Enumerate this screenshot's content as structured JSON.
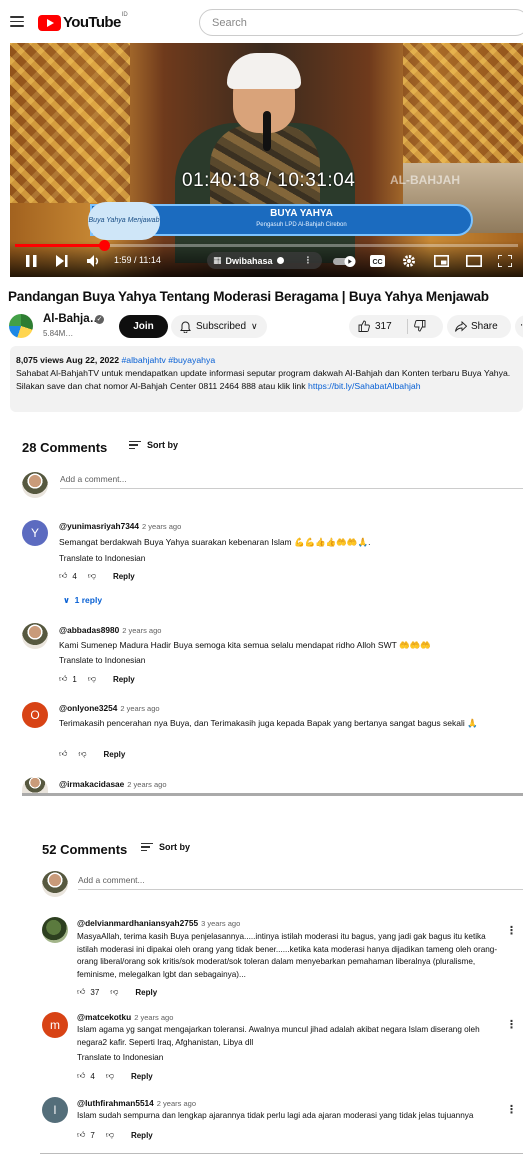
{
  "header": {
    "logo_text": "YouTube",
    "logo_country": "ID",
    "search_placeholder": "Search"
  },
  "player": {
    "overlay_timecode": "01:40:18 / 10:31:04",
    "watermark": "AL-BAHJAH",
    "banner_badge": "Buya Yahya Menjawab",
    "banner_name": "BUYA YAHYA",
    "banner_subtitle": "Pengasuh LPD Al-Bahjah Cirebon",
    "time_display": "1:59 / 11:14",
    "audio_track_label": "Dwibahasa",
    "progress_fraction": 0.177
  },
  "video": {
    "title": "Pandangan Buya Yahya Tentang Moderasi Beragama | Buya Yahya Menjawab",
    "channel_name": "Al-Bahja…",
    "subscribers": "5.84M…",
    "join_label": "Join",
    "subscribed_label": "Subscribed",
    "likes": "317",
    "share_label": "Share",
    "more_label": "⋯"
  },
  "description": {
    "meta": "8,075 views  Aug 22, 2022",
    "tags": "#albahjahtv #buyayahya",
    "text": "Sahabat Al-BahjahTV untuk mendapatkan update informasi seputar program dakwah Al-Bahjah dan Konten terbaru Buya Yahya. Silakan save dan chat nomor Al-Bahjah Center 0811 2464 888 atau klik link",
    "link": "https://bit.ly/SahabatAlbahjah"
  },
  "section1": {
    "count_label": "28 Comments",
    "sort_label": "Sort by",
    "add_placeholder": "Add a comment...",
    "comments": [
      {
        "avatar_letter": "Y",
        "avatar_color": "#5c6bc0",
        "author": "@yunimasriyah7344",
        "time": "2 years ago",
        "text": "Semangat berdakwah Buya Yahya suarakan kebenaran Islam 💪💪👍👍🤲🤲🙏.",
        "translate": "Translate to Indonesian",
        "likes": "4",
        "reply_label": "Reply",
        "replies_label": "1 reply"
      },
      {
        "avatar_letter": "",
        "avatar_color": "#e9e4dc",
        "author": "@abbadas8980",
        "time": "2 years ago",
        "text": "Kami Sumenep Madura Hadir Buya semoga kita semua selalu mendapat ridho Alloh SWT 🤲🤲🤲",
        "translate": "Translate to Indonesian",
        "likes": "1",
        "reply_label": "Reply"
      },
      {
        "avatar_letter": "O",
        "avatar_color": "#d84315",
        "author": "@onlyone3254",
        "time": "2 years ago",
        "text": "Terimakasih pencerahan nya Buya, dan Terimakasih juga kepada Bapak yang bertanya sangat bagus sekali 🙏",
        "likes": "",
        "reply_label": "Reply"
      },
      {
        "avatar_letter": "",
        "avatar_color": "#cccccc",
        "author": "@irmakacidasae",
        "time": "2 years ago"
      }
    ]
  },
  "section2": {
    "count_label": "52 Comments",
    "sort_label": "Sort by",
    "add_placeholder": "Add a comment...",
    "comments": [
      {
        "avatar_letter": "",
        "avatar_color": "#3f5a2a",
        "author": "@delvianmardhaniansyah2755",
        "time": "3 years ago",
        "text": "MasyaAllah, terima kasih Buya penjelasannya.....intinya istilah moderasi itu bagus, yang jadi gak bagus itu ketika istilah moderasi ini dipakai oleh orang yang tidak bener......ketika kata moderasi hanya dijadikan tameng oleh orang-orang liberal/orang sok kritis/sok moderat/sok toleran dalam menyebarkan pemahaman liberalnya (pluralisme, feminisme,  melegalkan lgbt dan sebagainya)...",
        "likes": "37",
        "reply_label": "Reply"
      },
      {
        "avatar_letter": "m",
        "avatar_color": "#d84315",
        "author": "@matcekotku",
        "time": "2 years ago",
        "text": "Islam agama yg sangat mengajarkan toleransi. Awalnya muncul jihad adalah akibat negara Islam diserang oleh negara2 kafir. Seperti Iraq, Afghanistan, Libya dll",
        "translate": "Translate to Indonesian",
        "likes": "4",
        "reply_label": "Reply"
      },
      {
        "avatar_letter": "l",
        "avatar_color": "#546e7a",
        "author": "@luthfirahman5514",
        "time": "2 years ago",
        "text": "Islam sudah sempurna dan lengkap ajarannya tidak perlu lagi ada ajaran moderasi yang tidak jelas tujuannya",
        "likes": "7",
        "reply_label": "Reply"
      }
    ]
  }
}
